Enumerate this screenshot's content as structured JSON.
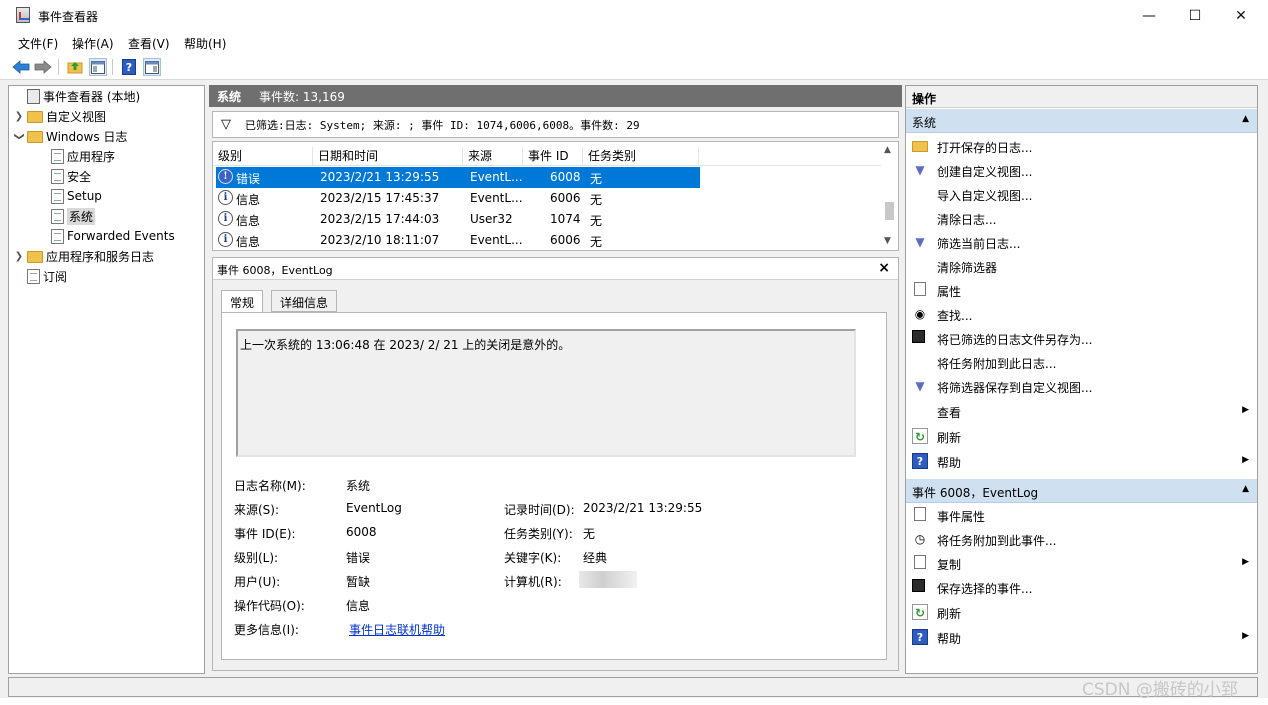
{
  "window": {
    "title": "事件查看器",
    "minimize": "—",
    "maximize": "☐",
    "close": "✕"
  },
  "menu": [
    "文件(F)",
    "操作(A)",
    "查看(V)",
    "帮助(H)"
  ],
  "tree": {
    "root": "事件查看器 (本地)",
    "custom_views": "自定义视图",
    "windows_logs": "Windows 日志",
    "application": "应用程序",
    "security": "安全",
    "setup": "Setup",
    "system": "系统",
    "forwarded": "Forwarded Events",
    "app_service_logs": "应用程序和服务日志",
    "subscriptions": "订阅"
  },
  "log_header": {
    "name": "系统",
    "count": "事件数: 13,169"
  },
  "filter_text": "已筛选:日志: System; 来源: ; 事件 ID: 1074,6006,6008。事件数: 29",
  "table": {
    "columns": [
      "级别",
      "日期和时间",
      "来源",
      "事件 ID",
      "任务类别"
    ],
    "rows": [
      {
        "level": "错误",
        "date": "2023/2/21 13:29:55",
        "source": "EventL...",
        "id": "6008",
        "task": "无",
        "icon": "!"
      },
      {
        "level": "信息",
        "date": "2023/2/15 17:45:37",
        "source": "EventL...",
        "id": "6006",
        "task": "无",
        "icon": "i"
      },
      {
        "level": "信息",
        "date": "2023/2/15 17:44:03",
        "source": "User32",
        "id": "1074",
        "task": "无",
        "icon": "i"
      },
      {
        "level": "信息",
        "date": "2023/2/10 18:11:07",
        "source": "EventL...",
        "id": "6006",
        "task": "无",
        "icon": "i"
      }
    ]
  },
  "detail": {
    "title": "事件 6008，EventLog",
    "close": "×",
    "tab_general": "常规",
    "tab_details": "详细信息",
    "message": "上一次系统的 13:06:48 在    2023/   2/   21 上的关闭是意外的。",
    "fields": {
      "log_name_label": "日志名称(M):",
      "log_name": "系统",
      "source_label": "来源(S):",
      "source": "EventLog",
      "recorded_label": "记录时间(D):",
      "recorded": "2023/2/21 13:29:55",
      "event_id_label": "事件 ID(E):",
      "event_id": "6008",
      "task_label": "任务类别(Y):",
      "task": "无",
      "level_label": "级别(L):",
      "level": "错误",
      "keywords_label": "关键字(K):",
      "keywords": "经典",
      "user_label": "用户(U):",
      "user": "暂缺",
      "computer_label": "计算机(R):",
      "opcode_label": "操作代码(O):",
      "opcode": "信息",
      "more_info_label": "更多信息(I):",
      "more_info_link": "事件日志联机帮助"
    }
  },
  "actions": {
    "header": "操作",
    "section1": "系统",
    "items1": [
      "打开保存的日志...",
      "创建自定义视图...",
      "导入自定义视图...",
      "清除日志...",
      "筛选当前日志...",
      "清除筛选器",
      "属性",
      "查找...",
      "将已筛选的日志文件另存为...",
      "将任务附加到此日志...",
      "将筛选器保存到自定义视图...",
      "查看",
      "刷新",
      "帮助"
    ],
    "section2": "事件 6008，EventLog",
    "items2": [
      "事件属性",
      "将任务附加到此事件...",
      "复制",
      "保存选择的事件...",
      "刷新",
      "帮助"
    ]
  },
  "watermark": "CSDN @搬砖的小郅"
}
